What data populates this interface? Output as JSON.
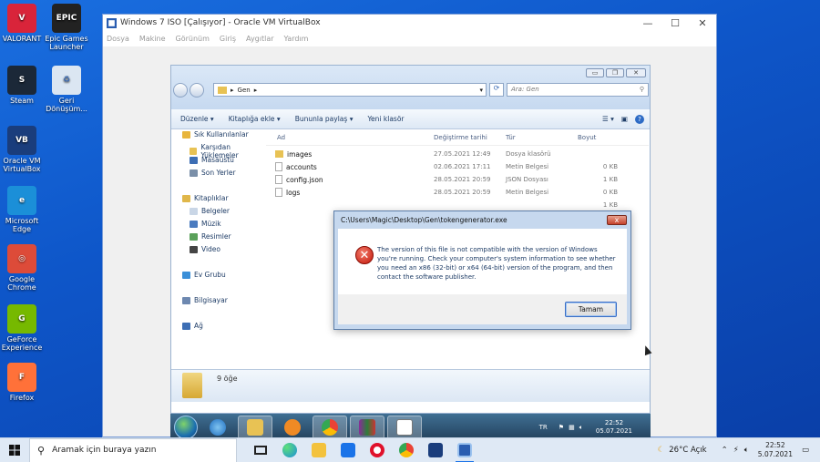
{
  "desktop": {
    "icons": [
      {
        "label": "VALORANT",
        "icon": "valorant-icon",
        "color": "#d9243a",
        "glyph": "V"
      },
      {
        "label": "Epic Games Launcher",
        "icon": "epic-games-icon",
        "color": "#222222",
        "glyph": "EPIC"
      },
      {
        "label": "Steam",
        "icon": "steam-icon",
        "color": "#1b2838",
        "glyph": "S"
      },
      {
        "label": "Geri Dönüşüm...",
        "icon": "recycle-bin-icon",
        "color": "#dbe6f2",
        "glyph": "♻"
      },
      {
        "label": "Oracle VM VirtualBox",
        "icon": "virtualbox-icon",
        "color": "#1a3d7c",
        "glyph": "VB"
      },
      {
        "label": "Microsoft Edge",
        "icon": "edge-icon",
        "color": "#1b8fd8",
        "glyph": "e"
      },
      {
        "label": "Google Chrome",
        "icon": "chrome-icon",
        "color": "#dd4b39",
        "glyph": "◎"
      },
      {
        "label": "GeForce Experience",
        "icon": "geforce-icon",
        "color": "#76b900",
        "glyph": "G"
      },
      {
        "label": "Firefox",
        "icon": "firefox-icon",
        "color": "#ff7139",
        "glyph": "F"
      }
    ]
  },
  "vbox": {
    "title": "Windows 7 ISO [Çalışıyor] - Oracle VM VirtualBox",
    "menu": [
      "Dosya",
      "Makine",
      "Görünüm",
      "Giriş",
      "Aygıtlar",
      "Yardım"
    ]
  },
  "explorer": {
    "path": "Gen",
    "search_placeholder": "Ara: Gen",
    "toolbar": [
      "Düzenle ▾",
      "Kitaplığa ekle ▾",
      "Bununla paylaş ▾",
      "Yeni klasör"
    ],
    "nav": [
      {
        "label": "Sık Kullanılanlar",
        "icon": "star-icon",
        "color": "#e8b53c"
      },
      {
        "label": "Karşıdan Yüklemeler",
        "icon": "downloads-icon",
        "color": "#e8c254"
      },
      {
        "label": "Masaüstü",
        "icon": "desktop-folder-icon",
        "color": "#3d6eb4"
      },
      {
        "label": "Son Yerler",
        "icon": "recent-places-icon",
        "color": "#7a8fa8"
      },
      {
        "label": "Kitaplıklar",
        "icon": "libraries-icon",
        "color": "#e0b74a"
      },
      {
        "label": "Belgeler",
        "icon": "documents-icon",
        "color": "#c9d6e6"
      },
      {
        "label": "Müzik",
        "icon": "music-icon",
        "color": "#4a7bbf"
      },
      {
        "label": "Resimler",
        "icon": "pictures-icon",
        "color": "#5aa05a"
      },
      {
        "label": "Video",
        "icon": "video-icon",
        "color": "#444444"
      },
      {
        "label": "Ev Grubu",
        "icon": "homegroup-icon",
        "color": "#3b8fd8"
      },
      {
        "label": "Bilgisayar",
        "icon": "computer-icon",
        "color": "#6d88b0"
      },
      {
        "label": "Ağ",
        "icon": "network-icon",
        "color": "#3d6eb4"
      }
    ],
    "columns": [
      "Ad",
      "Değiştirme tarihi",
      "Tür",
      "Boyut"
    ],
    "rows": [
      {
        "name": "images",
        "date": "27.05.2021 12:49",
        "type": "Dosya klasörü",
        "size": "",
        "kind": "folder"
      },
      {
        "name": "accounts",
        "date": "02.06.2021 17:11",
        "type": "Metin Belgesi",
        "size": "0 KB",
        "kind": "file"
      },
      {
        "name": "config.json",
        "date": "28.05.2021 20:59",
        "type": "JSON Dosyası",
        "size": "1 KB",
        "kind": "file"
      },
      {
        "name": "logs",
        "date": "28.05.2021 20:59",
        "type": "Metin Belgesi",
        "size": "0 KB",
        "kind": "file"
      },
      {
        "name": "",
        "date": "",
        "type": "",
        "size": "1 KB",
        "kind": "hidden"
      },
      {
        "name": "",
        "date": "",
        "type": "",
        "size": "0 KB",
        "kind": "hidden"
      },
      {
        "name": "",
        "date": "",
        "type": "",
        "size": "0 KB",
        "kind": "hidden"
      },
      {
        "name": "",
        "date": "",
        "type": "",
        "size": "2.909 KB",
        "kind": "hidden"
      },
      {
        "name": "",
        "date": "",
        "type": "",
        "size": "0 KB",
        "kind": "hidden"
      }
    ],
    "status": "9 öğe"
  },
  "dialog": {
    "title": "C:\\Users\\Magic\\Desktop\\Gen\\tokengenerator.exe",
    "message": "The version of this file is not compatible with the version of Windows you're running. Check your computer's system information to see whether you need an x86 (32-bit) or x64 (64-bit) version of the program, and then contact the software publisher.",
    "ok": "Tamam",
    "close": "x"
  },
  "w7taskbar": {
    "lang": "TR",
    "time": "22:52",
    "date": "05.07.2021"
  },
  "taskbar": {
    "search_placeholder": "Aramak için buraya yazın",
    "weather": "26°C  Açık",
    "time": "22:52",
    "date": "5.07.2021"
  }
}
